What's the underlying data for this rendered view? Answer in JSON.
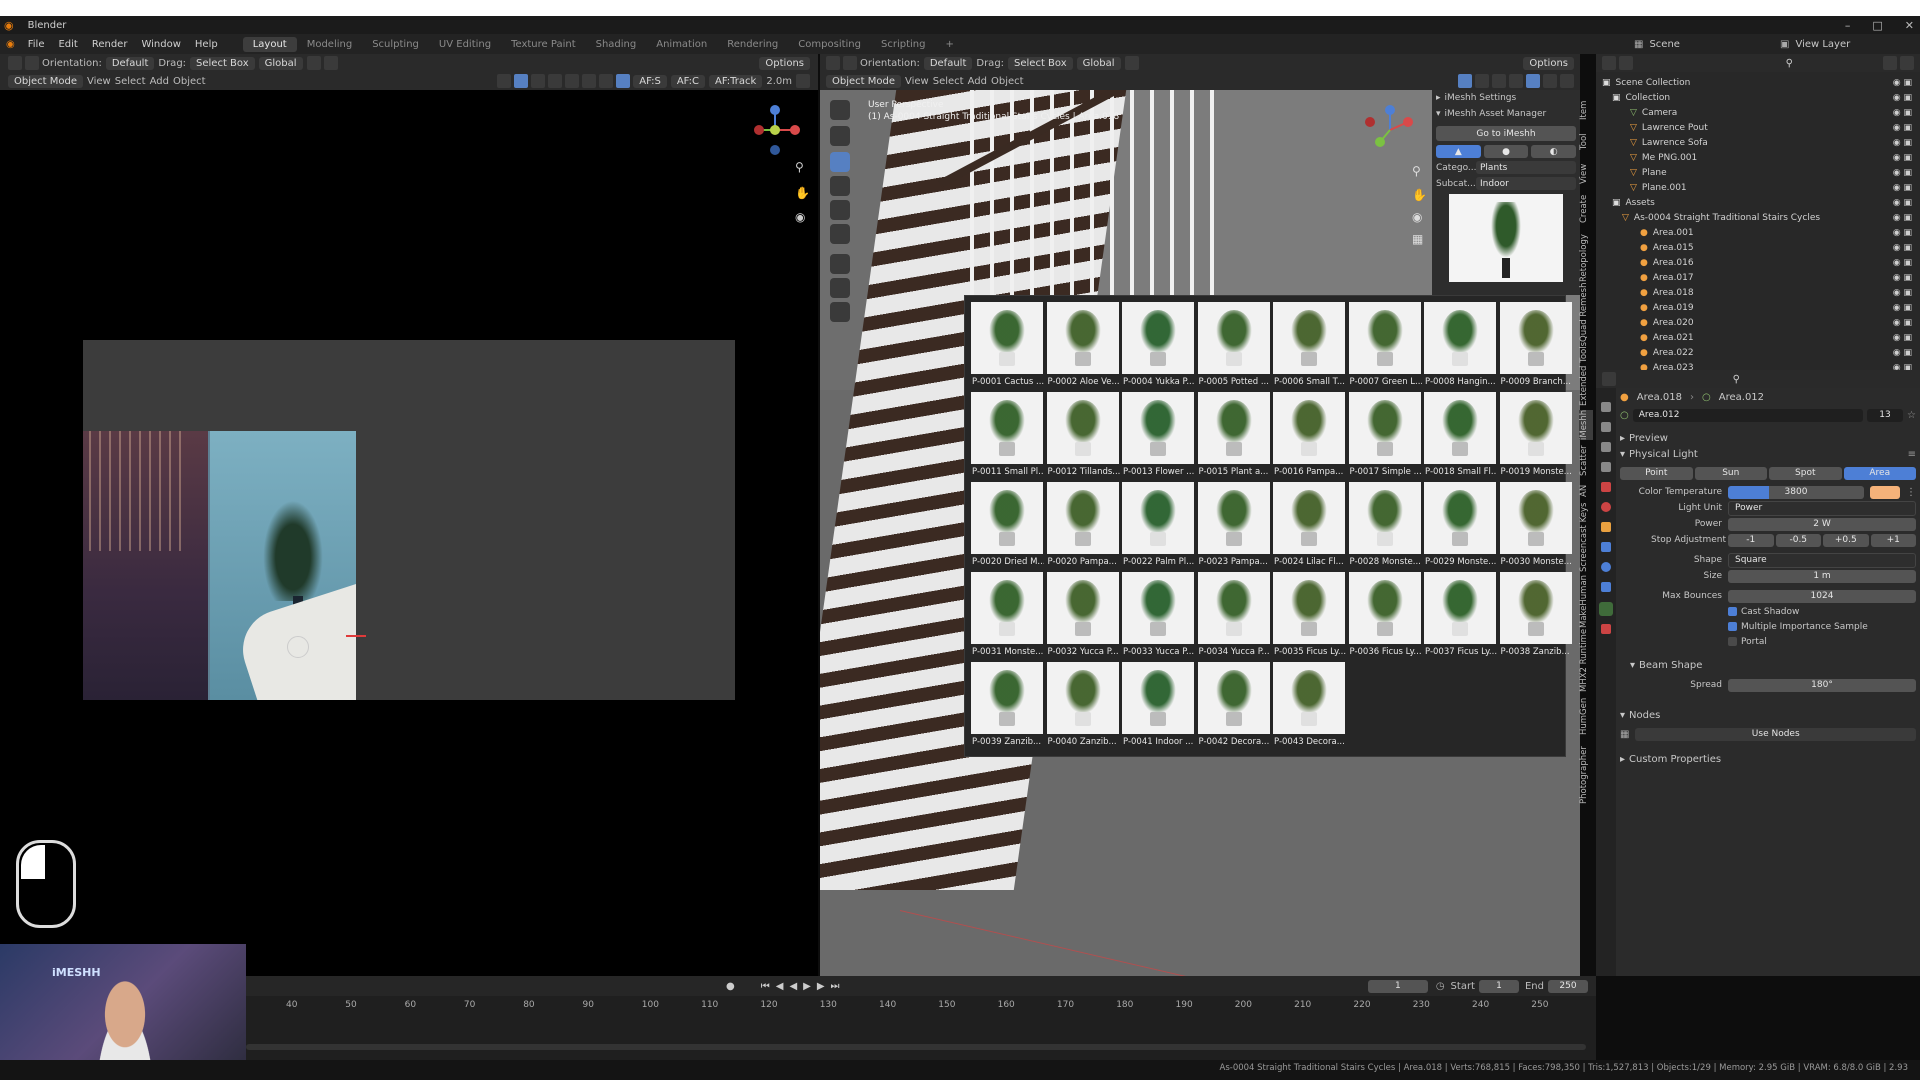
{
  "window": {
    "title": "Blender",
    "controls": [
      "–",
      "□",
      "✕"
    ]
  },
  "menu": {
    "items": [
      "File",
      "Edit",
      "Render",
      "Window",
      "Help"
    ],
    "workspaces": [
      "Layout",
      "Modeling",
      "Sculpting",
      "UV Editing",
      "Texture Paint",
      "Shading",
      "Animation",
      "Rendering",
      "Compositing",
      "Scripting",
      "+"
    ],
    "scene_label": "Scene",
    "view_layer_label": "View Layer"
  },
  "left_view": {
    "orientation_label": "Orientation:",
    "orientation_value": "Default",
    "drag_label": "Drag:",
    "drag_value": "Select Box",
    "transform": "Global",
    "options_label": "Options",
    "mode": "Object Mode",
    "menus": [
      "View",
      "Select",
      "Add",
      "Object"
    ],
    "af_s": "AF:S",
    "af_c": "AF:C",
    "af_track": "AF:Track",
    "distance": "2.0m"
  },
  "right_view": {
    "orientation_label": "Orientation:",
    "orientation_value": "Default",
    "drag_label": "Drag:",
    "drag_value": "Select Box",
    "transform": "Global",
    "options_label": "Options",
    "mode": "Object Mode",
    "menus": [
      "View",
      "Select",
      "Add",
      "Object"
    ],
    "perspective": "User Perspective",
    "active_info": "(1) As-0004 Straight Traditional Stairs Cycles | Area.018"
  },
  "imeshh": {
    "settings_label": "iMeshh Settings",
    "manager_label": "iMeshh Asset Manager",
    "goto_label": "Go to iMeshh",
    "category_label": "Catego...",
    "category_value": "Plants",
    "subcat_label": "Subcat...",
    "subcat_value": "Indoor"
  },
  "assets": [
    "P-0001 Cactus ...",
    "P-0002 Aloe Ve...",
    "P-0004 Yukka P...",
    "P-0005 Potted ...",
    "P-0006 Small T...",
    "P-0007 Green L...",
    "P-0008 Hangin...",
    "P-0009 Branch...",
    "P-0011 Small Pl...",
    "P-0012 Tillands...",
    "P-0013 Flower ...",
    "P-0015 Plant a...",
    "P-0016 Pampa...",
    "P-0017 Simple ...",
    "P-0018 Small Fl...",
    "P-0019 Monste...",
    "P-0020 Dried M...",
    "P-0020 Pampa...",
    "P-0022 Palm Pl...",
    "P-0023 Pampa...",
    "P-0024 Lilac Fl...",
    "P-0028 Monste...",
    "P-0029 Monste...",
    "P-0030 Monste...",
    "P-0031 Monste...",
    "P-0032 Yucca P...",
    "P-0033 Yucca P...",
    "P-0034 Yucca P...",
    "P-0035 Ficus Ly...",
    "P-0036 Ficus Ly...",
    "P-0037 Ficus Ly...",
    "P-0038 Zanzib...",
    "P-0039 Zanzib...",
    "P-0040 Zanzib...",
    "P-0041 Indoor ...",
    "P-0042 Decora...",
    "P-0043 Decora..."
  ],
  "side_tabs": [
    "Item",
    "Tool",
    "View",
    "Create",
    "Retopology",
    "Quad Remesh",
    "Extended Tools",
    "iMeshh",
    "Scatter",
    "AN",
    "Screencast Keys",
    "MakeHuman",
    "MHX2 Runtime",
    "HumGen",
    "Photographer"
  ],
  "outliner": {
    "root": "Scene Collection",
    "collection": "Collection",
    "objects": [
      "Camera",
      "Lawrence Pout",
      "Lawrence Sofa",
      "Me PNG.001",
      "Plane",
      "Plane.001"
    ],
    "assets_label": "Assets",
    "stairs": "As-0004 Straight Traditional Stairs Cycles",
    "areas": [
      "Area.001",
      "Area.015",
      "Area.016",
      "Area.017",
      "Area.018",
      "Area.019",
      "Area.020",
      "Area.021",
      "Area.022",
      "Area.023"
    ]
  },
  "properties": {
    "object_name": "Area.018",
    "data_name": "Area.012",
    "data_field": "Area.012",
    "users": "13",
    "preview_label": "Preview",
    "physical_light_label": "Physical Light",
    "light_types": [
      "Point",
      "Sun",
      "Spot",
      "Area"
    ],
    "active_type": "Area",
    "color_temp_label": "Color Temperature",
    "color_temp_value": "3800",
    "light_swatch": "#f5b27a",
    "light_unit_label": "Light Unit",
    "light_unit_value": "Power",
    "power_label": "Power",
    "power_value": "2 W",
    "stop_label": "Stop Adjustment",
    "stops": [
      "-1",
      "-0.5",
      "+0.5",
      "+1"
    ],
    "shape_label": "Shape",
    "shape_value": "Square",
    "size_label": "Size",
    "size_value": "1 m",
    "bounces_label": "Max Bounces",
    "bounces_value": "1024",
    "cast_shadow": "Cast Shadow",
    "mis": "Multiple Importance Sample",
    "portal": "Portal",
    "beam_label": "Beam Shape",
    "spread_label": "Spread",
    "spread_value": "180°",
    "nodes_label": "Nodes",
    "use_nodes": "Use Nodes",
    "custom_label": "Custom Properties"
  },
  "timeline": {
    "frame": "1",
    "start_label": "Start",
    "start": "1",
    "end_label": "End",
    "end": "250",
    "ticks": [
      "40",
      "50",
      "60",
      "70",
      "80",
      "90",
      "100",
      "110",
      "120",
      "130",
      "140",
      "150",
      "160",
      "170",
      "180",
      "190",
      "200",
      "210",
      "220",
      "230",
      "240",
      "250"
    ]
  },
  "status": {
    "text": "As-0004 Straight Traditional Stairs Cycles | Area.018 | Verts:768,815 | Faces:798,350 | Tris:1,527,813 | Objects:1/29 | Memory: 2.95 GiB | VRAM: 6.8/8.0 GiB | 2.93"
  },
  "webcam": {
    "logo": "iMESHH"
  },
  "colors": {
    "accent": "#4d7fd6",
    "header": "#2a2a2a",
    "panel": "#2b2b2b"
  }
}
